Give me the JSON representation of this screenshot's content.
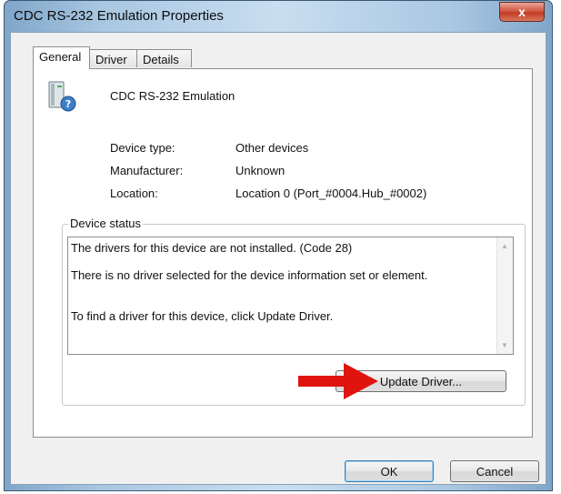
{
  "window": {
    "title": "CDC RS-232 Emulation Properties",
    "close_label": "x"
  },
  "tabs": [
    {
      "label": "General",
      "active": true
    },
    {
      "label": "Driver",
      "active": false
    },
    {
      "label": "Details",
      "active": false
    }
  ],
  "device": {
    "name": "CDC RS-232 Emulation",
    "icon": "usb-device-unknown-icon",
    "properties": [
      {
        "label": "Device type:",
        "value": "Other devices"
      },
      {
        "label": "Manufacturer:",
        "value": "Unknown"
      },
      {
        "label": "Location:",
        "value": "Location 0 (Port_#0004.Hub_#0002)"
      }
    ]
  },
  "status": {
    "group_label": "Device status",
    "lines": [
      "The drivers for this device are not installed. (Code 28)",
      "There is no driver selected for the device information set or element.",
      "To find a driver for this device, click Update Driver."
    ],
    "update_button_label": "Update Driver..."
  },
  "buttons": {
    "ok": "OK",
    "cancel": "Cancel"
  },
  "colors": {
    "arrow": "#e0140f",
    "close": "#c23b23"
  }
}
